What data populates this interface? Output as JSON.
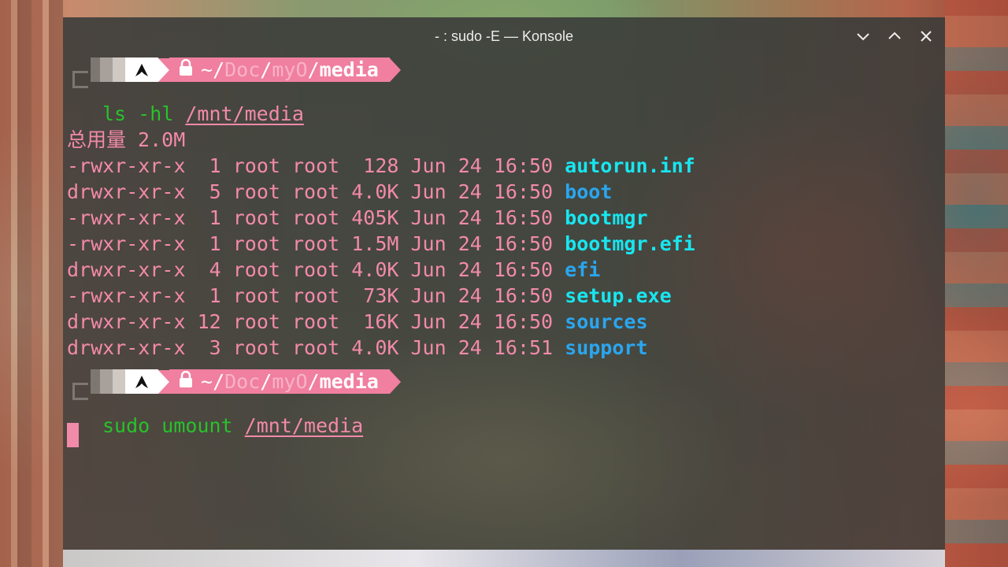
{
  "window": {
    "title": "- : sudo -E — Konsole",
    "controls": {
      "minimize_icon": "chevron-down-icon",
      "maximize_icon": "chevron-up-icon",
      "close_icon": "close-icon"
    }
  },
  "colors": {
    "prompt_path_bg": "#f07fa0",
    "command_green": "#27c22a",
    "text_pink": "#f28aa9",
    "file_cyan": "#18e6f0",
    "dir_blue": "#2aa6f0"
  },
  "prompt1": {
    "os_icon": "arch-linux-icon",
    "lock_icon": "lock-icon",
    "tilde": "~",
    "seg1": "Doc",
    "seg2": "myO",
    "current": "media",
    "command": "ls -hl",
    "argument": "/mnt/media"
  },
  "total_line": "总用量 2.0M",
  "listing": [
    {
      "meta": "-rwxr-xr-x  1 root root  128 Jun 24 16:50 ",
      "name": "autorun.inf",
      "type": "file"
    },
    {
      "meta": "drwxr-xr-x  5 root root 4.0K Jun 24 16:50 ",
      "name": "boot",
      "type": "dir"
    },
    {
      "meta": "-rwxr-xr-x  1 root root 405K Jun 24 16:50 ",
      "name": "bootmgr",
      "type": "file"
    },
    {
      "meta": "-rwxr-xr-x  1 root root 1.5M Jun 24 16:50 ",
      "name": "bootmgr.efi",
      "type": "file"
    },
    {
      "meta": "drwxr-xr-x  4 root root 4.0K Jun 24 16:50 ",
      "name": "efi",
      "type": "dir"
    },
    {
      "meta": "-rwxr-xr-x  1 root root  73K Jun 24 16:50 ",
      "name": "setup.exe",
      "type": "file"
    },
    {
      "meta": "drwxr-xr-x 12 root root  16K Jun 24 16:50 ",
      "name": "sources",
      "type": "dir"
    },
    {
      "meta": "drwxr-xr-x  3 root root 4.0K Jun 24 16:51 ",
      "name": "support",
      "type": "dir"
    }
  ],
  "prompt2": {
    "os_icon": "arch-linux-icon",
    "lock_icon": "lock-icon",
    "tilde": "~",
    "seg1": "Doc",
    "seg2": "myO",
    "current": "media",
    "command_sudo": "sudo",
    "command": "umount",
    "argument": "/mnt/media"
  }
}
